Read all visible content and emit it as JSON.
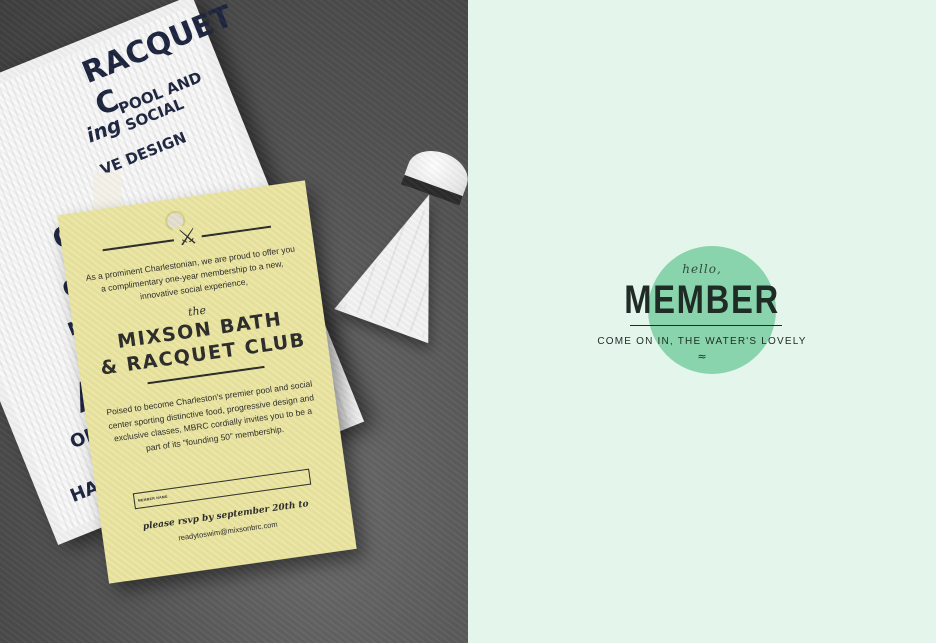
{
  "photo": {
    "towel": {
      "texts": [
        "RACQUET C",
        "POOL AND SOCIAL",
        "ing",
        "VE DESIGN",
        "OBE",
        "O'CL",
        "NES AN",
        "ARN",
        "ON",
        "HARLESE"
      ]
    },
    "tag": {
      "intro": "As a prominent Charlestonian, we are proud to offer you a complimentary one-year membership to a new, innovative social experience,",
      "the": "the",
      "club_line1": "MIXSON BATH",
      "club_line2": "& RACQUET CLUB",
      "description": "Poised to become Charleston's premier pool and social center sporting distinctive food, progressive design and exclusive classes, MBRC cordially invites you to be a part of its \"founding 50\" membership.",
      "field_label": "MEMBER NAME",
      "rsvp": "please rsvp by september 20th to",
      "email": "readytoswim@mixsonbrc.com",
      "icon": "crossed-racquets-icon"
    }
  },
  "panel": {
    "hello": "hello,",
    "title": "MEMBER",
    "tagline": "COME ON IN, THE WATER'S LOVELY",
    "wave": "≈",
    "circle_color": "#8ad4ad",
    "background_color": "#e4f5ec"
  }
}
